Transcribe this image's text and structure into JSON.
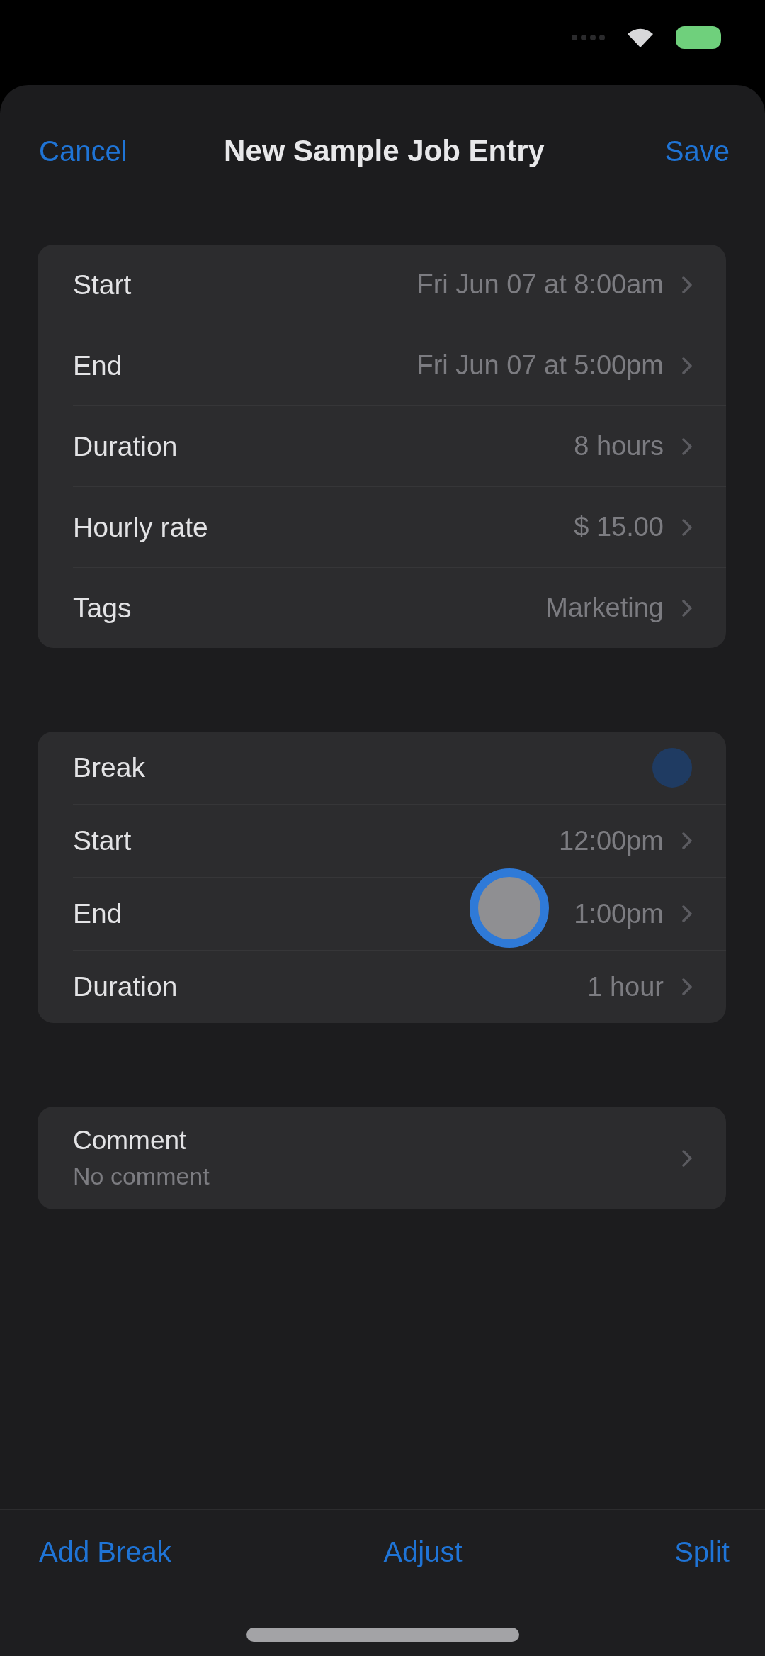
{
  "nav": {
    "cancel": "Cancel",
    "title": "New Sample Job Entry",
    "save": "Save"
  },
  "sections": [
    {
      "rows": [
        {
          "kind": "value",
          "label": "Start",
          "value": "Fri Jun 07 at 8:00am"
        },
        {
          "kind": "value",
          "label": "End",
          "value": "Fri Jun 07 at 5:00pm"
        },
        {
          "kind": "value",
          "label": "Duration",
          "value": "8 hours"
        },
        {
          "kind": "value",
          "label": "Hourly rate",
          "value": "$ 15.00"
        },
        {
          "kind": "value",
          "label": "Tags",
          "value": "Marketing"
        }
      ]
    },
    {
      "rows": [
        {
          "kind": "indicator",
          "label": "Break"
        },
        {
          "kind": "value",
          "label": "Start",
          "value": "12:00pm"
        },
        {
          "kind": "value",
          "label": "End",
          "value": "1:00pm"
        },
        {
          "kind": "value",
          "label": "Duration",
          "value": "1 hour"
        }
      ]
    },
    {
      "rows": [
        {
          "kind": "comment",
          "label": "Comment",
          "detail": "No comment"
        }
      ]
    }
  ],
  "toolbar": [
    "Add Break",
    "Adjust",
    "Split"
  ]
}
